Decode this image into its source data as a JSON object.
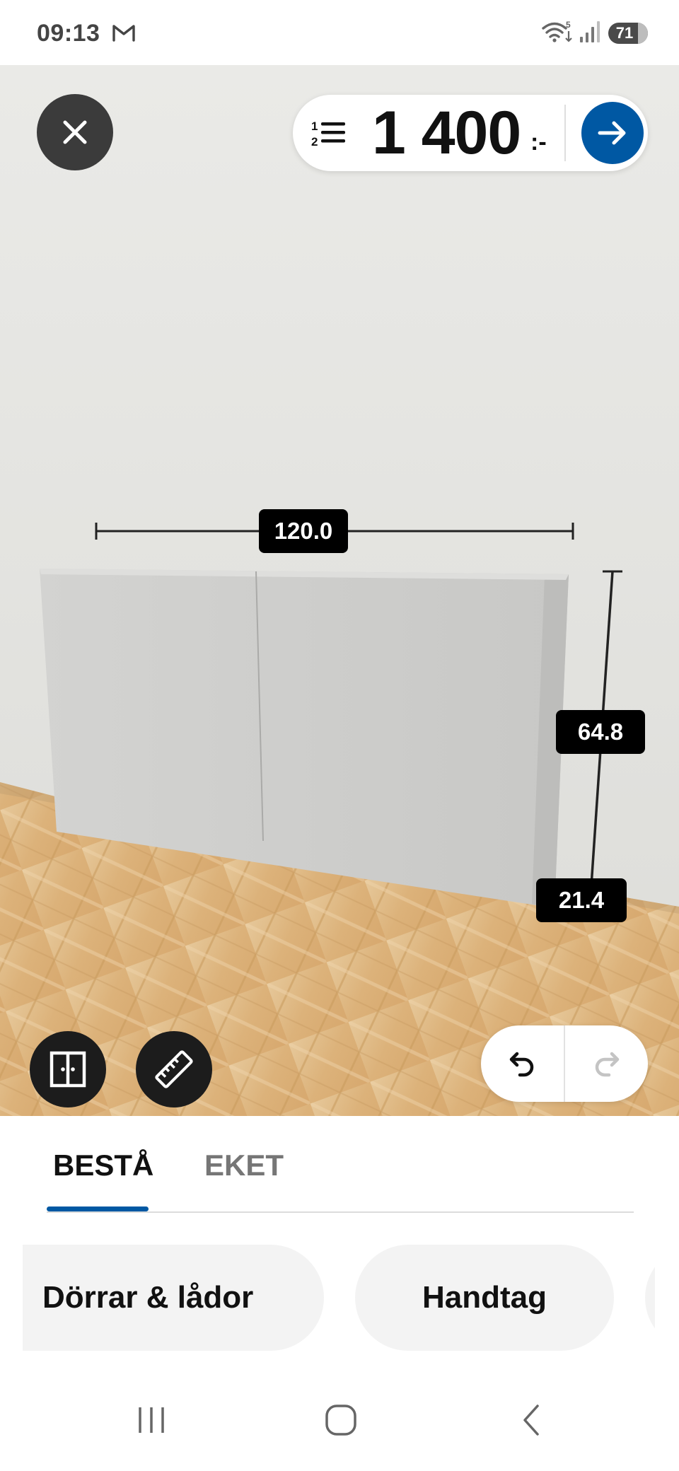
{
  "status_bar": {
    "time": "09:13",
    "notification_icons": [
      "gmail-icon"
    ],
    "system_icons": [
      "wifi-icon",
      "signal-icon"
    ],
    "wifi_label": "5",
    "battery_level": "71"
  },
  "header": {
    "close_icon": "close-icon",
    "list_icon": "numbered-list-icon",
    "price": "1 400",
    "price_suffix": ":-",
    "go_icon": "arrow-right-icon",
    "accent_color": "#0058a3"
  },
  "dimensions": {
    "width": "120.0",
    "height": "64.8",
    "depth": "21.4"
  },
  "tools": {
    "doors_icon": "double-door-icon",
    "measure_icon": "ruler-icon",
    "undo_icon": "undo-icon",
    "redo_icon": "redo-icon",
    "redo_enabled": false
  },
  "tabs": [
    {
      "label": "BESTÅ",
      "active": true
    },
    {
      "label": "EKET",
      "active": false
    }
  ],
  "categories": [
    {
      "label": "Dörrar & lådor"
    },
    {
      "label": "Handtag"
    }
  ],
  "nav": {
    "recents_icon": "recents-icon",
    "home_icon": "home-icon",
    "back_icon": "back-icon"
  }
}
